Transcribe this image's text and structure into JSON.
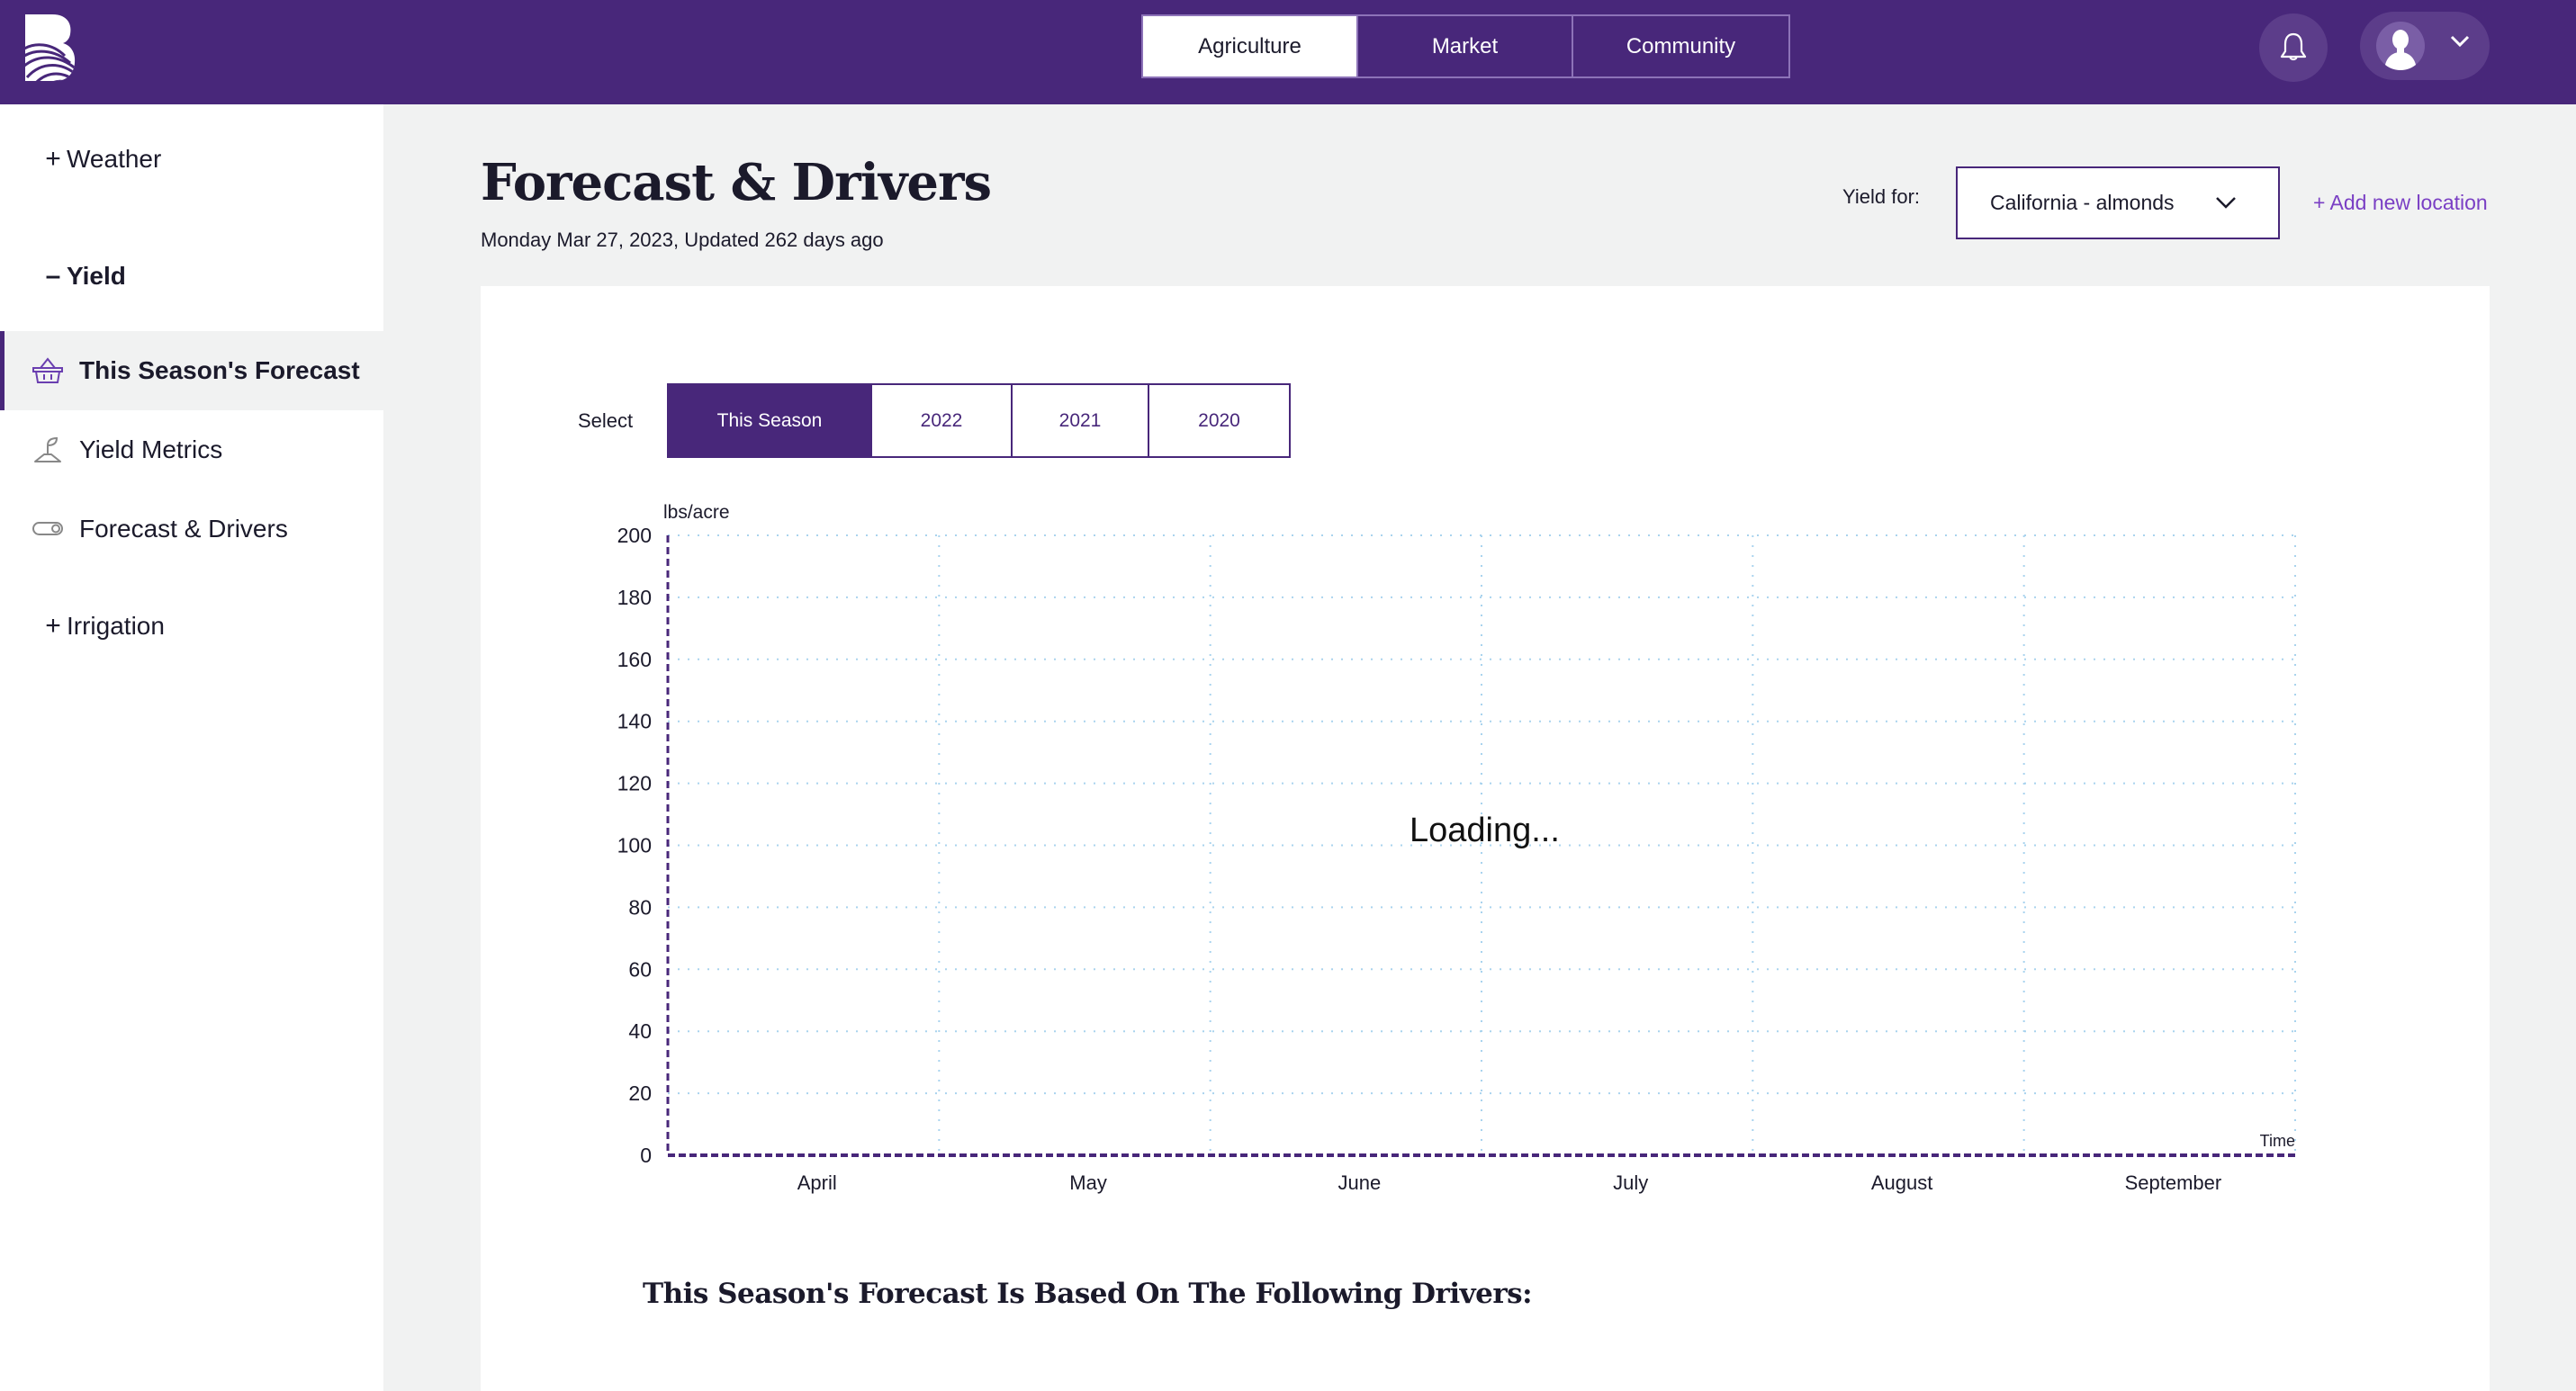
{
  "brand": {
    "logo_icon": "brand-b-logo-icon",
    "header_color": "#48277a",
    "accent_link_color": "#7a3fc4"
  },
  "nav": {
    "tabs": [
      {
        "label": "Agriculture",
        "active": true
      },
      {
        "label": "Market",
        "active": false
      },
      {
        "label": "Community",
        "active": false
      }
    ],
    "icons": {
      "notifications": "bell-icon",
      "user": "user-avatar-icon",
      "menu": "chevron-down-icon"
    }
  },
  "sidebar": {
    "sections": [
      {
        "sign": "+",
        "label": "Weather",
        "expanded": false
      },
      {
        "sign": "–",
        "label": "Yield",
        "expanded": true
      },
      {
        "sign": "+",
        "label": "Irrigation",
        "expanded": false
      }
    ],
    "yield_items": [
      {
        "label": "This Season's Forecast",
        "icon": "basket-icon",
        "active": true
      },
      {
        "label": "Yield Metrics",
        "icon": "sprout-icon",
        "active": false
      },
      {
        "label": "Forecast & Drivers",
        "icon": "toggle-icon",
        "active": false
      }
    ]
  },
  "page": {
    "title": "Forecast & Drivers",
    "subtitle": "Monday Mar 27, 2023, Updated 262 days ago",
    "yield_for_label": "Yield for:",
    "yield_for_value": "California - almonds",
    "add_location": "+ Add new location"
  },
  "season_select": {
    "label": "Select",
    "options": [
      {
        "label": "This Season",
        "active": true
      },
      {
        "label": "2022",
        "active": false
      },
      {
        "label": "2021",
        "active": false
      },
      {
        "label": "2020",
        "active": false
      }
    ]
  },
  "chart_data": {
    "type": "line",
    "title": "",
    "ylabel": "lbs/acre",
    "xlabel": "Time",
    "ylim": [
      0,
      200
    ],
    "yticks": [
      0,
      20,
      40,
      60,
      80,
      100,
      120,
      140,
      160,
      180,
      200
    ],
    "categories": [
      "April",
      "May",
      "June",
      "July",
      "August",
      "September"
    ],
    "series": [],
    "grid": true,
    "status": "Loading..."
  },
  "drivers": {
    "heading": "This Season's Forecast Is Based On The Following Drivers:"
  }
}
